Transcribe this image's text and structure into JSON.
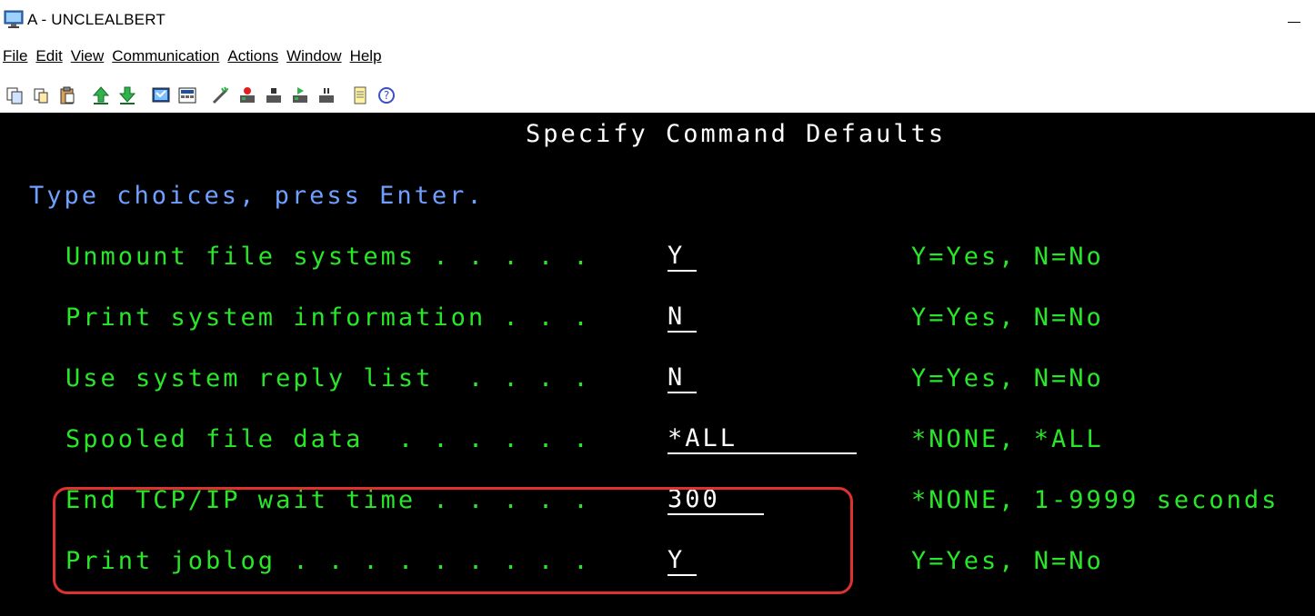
{
  "window": {
    "title": "A - UNCLEALBERT"
  },
  "menu": {
    "items": [
      {
        "label": "File"
      },
      {
        "label": "Edit"
      },
      {
        "label": "View"
      },
      {
        "label": "Communication"
      },
      {
        "label": "Actions"
      },
      {
        "label": "Window"
      },
      {
        "label": "Help"
      }
    ]
  },
  "screen": {
    "heading": "Specify Command Defaults",
    "instruction": "Type choices, press Enter.",
    "fields": [
      {
        "label": "Unmount file systems . . . . .",
        "value": "Y",
        "hint": "Y=Yes, N=No"
      },
      {
        "label": "Print system information . . .",
        "value": "N",
        "hint": "Y=Yes, N=No"
      },
      {
        "label": "Use system reply list  . . . .",
        "value": "N",
        "hint": "Y=Yes, N=No"
      },
      {
        "label": "Spooled file data  . . . . . .",
        "value": "*ALL",
        "hint": "*NONE, *ALL"
      },
      {
        "label": "End TCP/IP wait time . . . . .",
        "value": "300",
        "hint": "*NONE, 1-9999 seconds"
      },
      {
        "label": "Print joblog . . . . . . . . .",
        "value": "Y",
        "hint": "Y=Yes, N=No"
      }
    ]
  },
  "colors": {
    "screen_bg": "#000000",
    "heading": "#ffffff",
    "instruction": "#6f9fff",
    "field_label": "#28e628",
    "field_value": "#ffffff",
    "highlight": "#e03030"
  }
}
